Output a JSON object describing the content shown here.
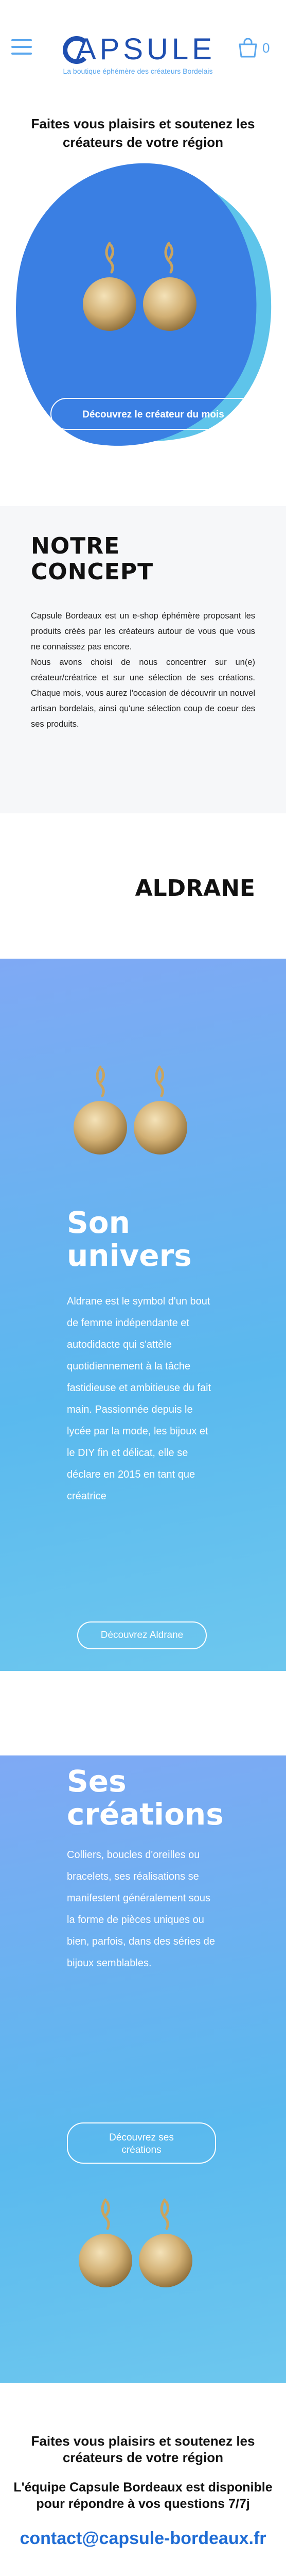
{
  "header": {
    "logo_word": "APSULE",
    "tagline": "La boutique éphémère des créateurs Bordelais",
    "cart_count": "0"
  },
  "hero": {
    "title": "Faites vous plaisirs et soutenez les créateurs de votre région",
    "cta_label": "Découvrez le créateur du mois"
  },
  "concept": {
    "title_line1": "NOTRE",
    "title_line2": "CONCEPT",
    "paragraph1": "Capsule Bordeaux est un e-shop éphémère proposant les produits créés par les créateurs autour de vous que vous ne connaissez pas encore.",
    "paragraph2": "Nous avons choisi de nous concentrer sur un(e) créateur/créatrice et sur une sélection de ses créations. Chaque mois, vous aurez l'occasion de découvrir un nouvel artisan bordelais, ainsi qu'une sélection coup de coeur des ses produits."
  },
  "artisan": {
    "name": "ALDRANE"
  },
  "univers": {
    "title_line1": "Son",
    "title_line2": "univers",
    "text": "Aldrane est le symbol d'un bout de femme indépendante et autodidacte qui s'attèle quotidiennement à la tâche fastidieuse et ambitieuse du fait main. Passionnée depuis le lycée par la mode, les bijoux et le DIY fin et délicat, elle se déclare en 2015 en tant que créatrice",
    "button_label": "Découvrez Aldrane"
  },
  "creations": {
    "title_line1": "Ses",
    "title_line2": "créations",
    "text": "Colliers, boucles d'oreilles ou bracelets, ses réalisations se manifestent généralement sous la forme de pièces uniques ou bien, parfois, dans des séries de bijoux semblables.",
    "button_label": "Découvrez ses créations"
  },
  "footer": {
    "tagline": "Faites vous plaisirs et soutenez les créateurs de votre région",
    "availability": "L'équipe Capsule Bordeaux est disponible pour répondre à vos questions 7/7j",
    "email": "contact@capsule-bordeaux.fr"
  },
  "colors": {
    "brand_dark": "#1f4fb0",
    "brand_light": "#5aa7ee",
    "blob_blue": "#3a7fe3",
    "blob_cyan": "#5ec4ea",
    "link": "#1f6cd4"
  },
  "icons": [
    "hamburger-menu-icon",
    "shopping-bag-icon",
    "capsule-logo-c"
  ]
}
